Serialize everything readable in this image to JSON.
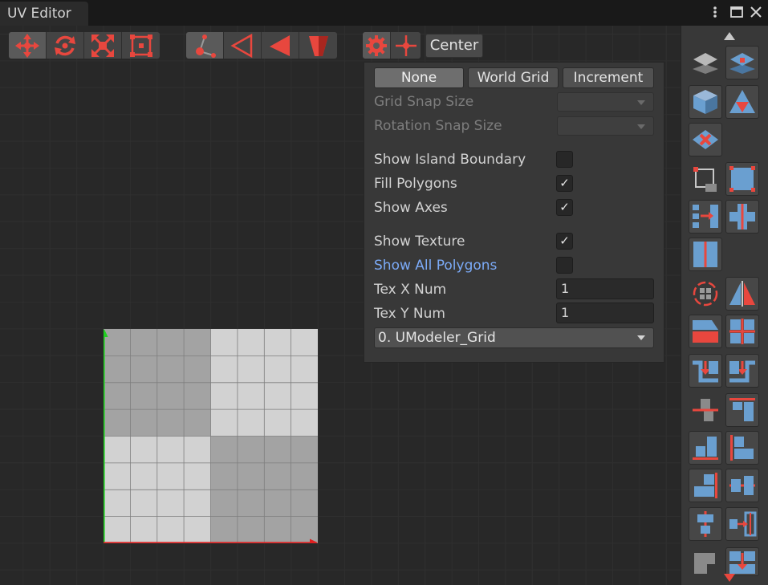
{
  "window": {
    "title": "UV Editor",
    "menu_icon": "kebab-menu-icon",
    "maximize_icon": "maximize-icon",
    "close_icon": "close-icon"
  },
  "toolbar": {
    "transform_tools": [
      "move-tool-icon",
      "rotate-tool-icon",
      "scale-tool-icon",
      "rect-tool-icon"
    ],
    "selection_modes": [
      "vertex-mode-icon",
      "edge-mode-icon",
      "face-mode-icon",
      "object-mode-icon"
    ],
    "settings_icon": "gear-icon",
    "pivot_icon": "pivot-icon",
    "pivot_label": "Center"
  },
  "snap": {
    "modes": [
      "None",
      "World Grid",
      "Increment"
    ],
    "selected": "None",
    "grid_snap_label": "Grid Snap Size",
    "rotation_snap_label": "Rotation Snap Size"
  },
  "options": {
    "show_island_boundary": {
      "label": "Show Island Boundary",
      "checked": false
    },
    "fill_polygons": {
      "label": "Fill Polygons",
      "checked": true
    },
    "show_axes": {
      "label": "Show Axes",
      "checked": true
    },
    "show_texture": {
      "label": "Show Texture",
      "checked": true
    },
    "show_all_polygons": {
      "label": "Show All Polygons",
      "checked": false
    },
    "check_mark": "✓"
  },
  "texture": {
    "tex_x_label": "Tex X Num",
    "tex_x_value": "1",
    "tex_y_label": "Tex Y Num",
    "tex_y_value": "1",
    "selected": "0. UModeler_Grid"
  },
  "colors": {
    "accent_red": "#e8473e",
    "accent_blue": "#6a9fd0",
    "link_blue": "#7baaf7",
    "axis_green": "#20d020",
    "axis_red": "#e02020"
  }
}
